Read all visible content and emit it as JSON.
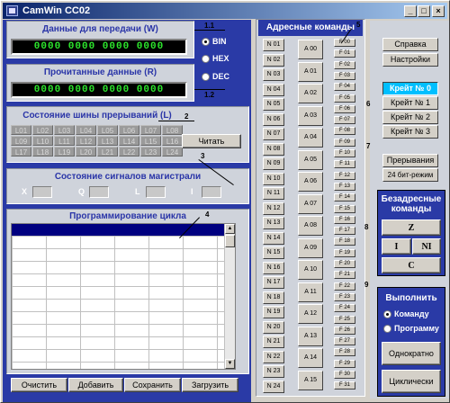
{
  "window": {
    "title": "CamWin CC02",
    "minimize": "_",
    "maximize": "□",
    "close": "×"
  },
  "data_out": {
    "label": "Данные для передачи (W)",
    "value": "0000 0000 0000 0000"
  },
  "data_in": {
    "label": "Прочитанные данные (R)",
    "value": "0000 0000 0000 0000"
  },
  "radix": {
    "options": [
      "BIN",
      "HEX",
      "DEC"
    ],
    "selected": "BIN"
  },
  "interrupts": {
    "label": "Состояние шины прерываний (L)",
    "cells": [
      "L01",
      "L02",
      "L03",
      "L04",
      "L05",
      "L06",
      "L07",
      "L08",
      "L09",
      "L10",
      "L11",
      "L12",
      "L13",
      "L14",
      "L15",
      "L16",
      "L17",
      "L18",
      "L19",
      "L20",
      "L21",
      "L22",
      "L23",
      "L24"
    ],
    "read_button": "Читать"
  },
  "signals": {
    "label": "Состояние сигналов магистрали",
    "items": [
      "X",
      "Q",
      "L",
      "I"
    ]
  },
  "cycle": {
    "label": "Программирование цикла"
  },
  "bottom_buttons": [
    "Очистить",
    "Добавить",
    "Сохранить",
    "Загрузить"
  ],
  "addr": {
    "label": "Адресные команды",
    "n": [
      "N 01",
      "N 02",
      "N 03",
      "N 04",
      "N 05",
      "N 06",
      "N 07",
      "N 08",
      "N 09",
      "N 10",
      "N 11",
      "N 12",
      "N 13",
      "N 14",
      "N 15",
      "N 16",
      "N 17",
      "N 18",
      "N 19",
      "N 20",
      "N 21",
      "N 22",
      "N 23",
      "N 24"
    ],
    "a": [
      "A 00",
      "A 01",
      "A 02",
      "A 03",
      "A 04",
      "A 05",
      "A 06",
      "A 07",
      "A 08",
      "A 09",
      "A 10",
      "A 11",
      "A 12",
      "A 13",
      "A 14",
      "A 15"
    ],
    "f": [
      "F 00",
      "F 01",
      "F 02",
      "F 03",
      "F 04",
      "F 05",
      "F 06",
      "F 07",
      "F 08",
      "F 09",
      "F 10",
      "F 11",
      "F 12",
      "F 13",
      "F 14",
      "F 15",
      "F 16",
      "F 17",
      "F 18",
      "F 19",
      "F 20",
      "F 21",
      "F 22",
      "F 23",
      "F 24",
      "F 25",
      "F 26",
      "F 27",
      "F 28",
      "F 29",
      "F 30",
      "F 31"
    ]
  },
  "help": {
    "help": "Справка",
    "settings": "Настройки"
  },
  "crates": {
    "items": [
      "Крейт № 0",
      "Крейт № 1",
      "Крейт № 2",
      "Крейт № 3"
    ],
    "selected": "Крейт № 0"
  },
  "irq": {
    "interrupts": "Прерывания",
    "mode24": "24 бит-режим"
  },
  "nonaddr": {
    "label": "Безадресные команды",
    "z": "Z",
    "i": "I",
    "ni": "NI",
    "c": "C"
  },
  "execute": {
    "label": "Выполнить",
    "options": [
      "Команду",
      "Программу"
    ],
    "selected": "Команду",
    "once": "Однократно",
    "cyclic": "Циклически"
  },
  "annotations": [
    "1.1",
    "1.2",
    "2",
    "3",
    "4",
    "5",
    "6",
    "7",
    "8",
    "9"
  ],
  "colors": {
    "title_start": "#0a246a",
    "title_end": "#a6caf0",
    "panel_blue": "#2a3aa6",
    "led_text": "#2de62d",
    "crate_selected": "#00bfff"
  }
}
